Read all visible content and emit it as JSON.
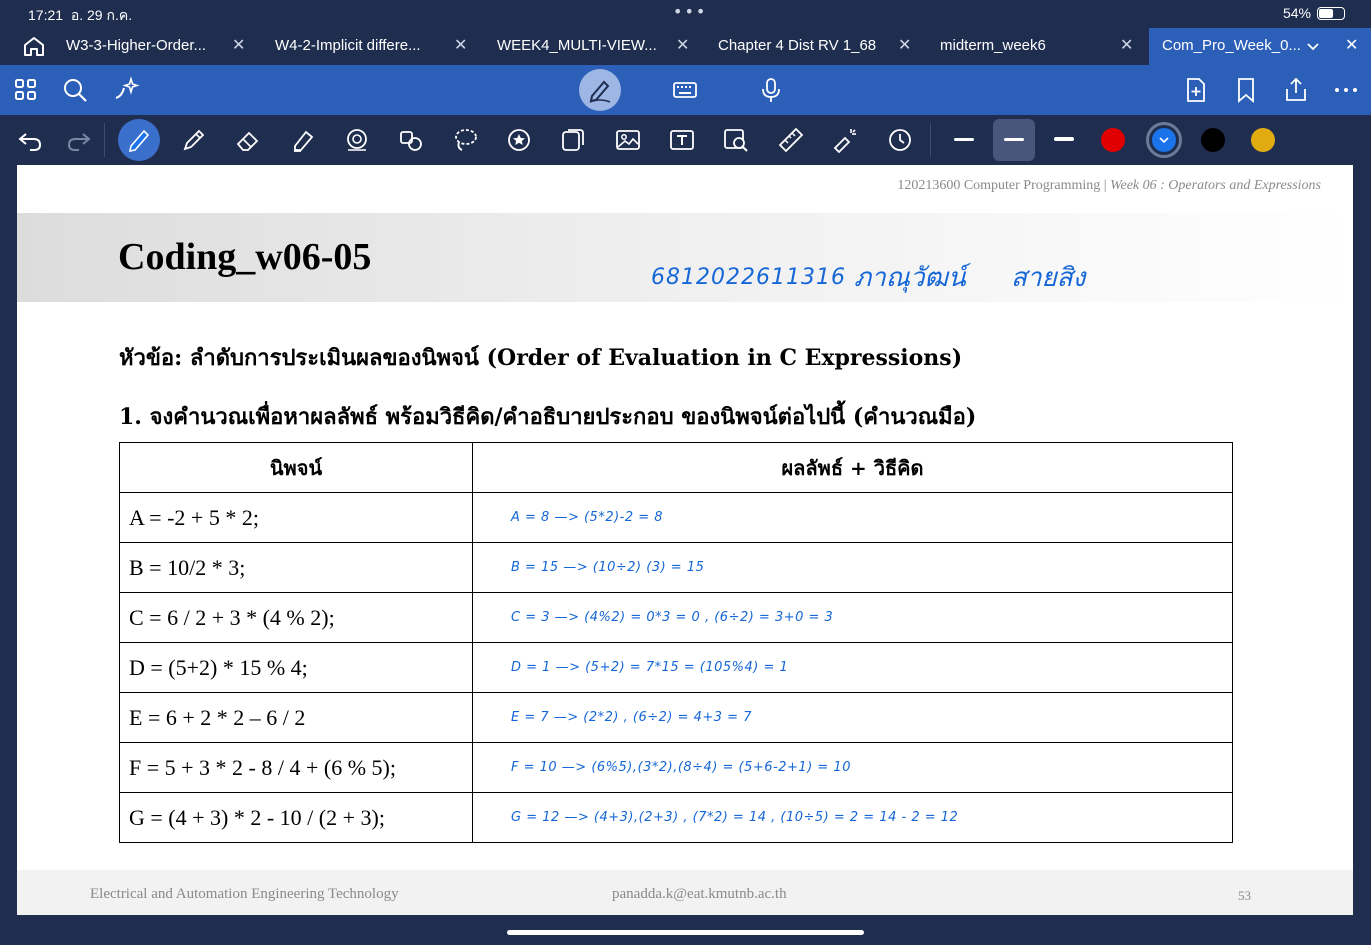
{
  "status": {
    "time": "17:21",
    "date": "อ. 29 ก.ค.",
    "dots": "•••",
    "battery": "54%"
  },
  "tabs": [
    {
      "label": "W3-3-Higher-Order...",
      "active": false
    },
    {
      "label": "W4-2-Implicit differe...",
      "active": false
    },
    {
      "label": "WEEK4_MULTI-VIEW...",
      "active": false
    },
    {
      "label": "Chapter 4 Dist RV 1_68",
      "active": false
    },
    {
      "label": "midterm_week6",
      "active": false
    },
    {
      "label": "Com_Pro_Week_0...",
      "active": true
    }
  ],
  "toolbar_top": {
    "left_icons": [
      "grid-icon",
      "search-icon",
      "sparkle-icon"
    ],
    "center_icons": [
      "pen-icon",
      "keyboard-icon",
      "microphone-icon"
    ],
    "right_icons": [
      "new-page-icon",
      "bookmark-icon",
      "share-icon",
      "more-icon"
    ]
  },
  "toolbar_tools": {
    "icons": [
      "undo-icon",
      "redo-icon",
      "pen-icon",
      "pencil-icon",
      "eraser-icon",
      "highlighter-icon",
      "shapes-icon",
      "elements-icon",
      "lasso-icon",
      "sticker-icon",
      "tape-icon",
      "image-icon",
      "textbox-icon",
      "camera-scan-icon",
      "ruler-icon",
      "laser-pointer-icon",
      "history-icon"
    ],
    "colors": {
      "red": "#e00000",
      "blue": "#1a73e8",
      "black": "#000000",
      "yellow": "#e0ac12"
    }
  },
  "slide": {
    "header_left": "120213600 Computer Programming | ",
    "header_right": "Week 06 : Operators and Expressions",
    "title": "Coding_w06-05",
    "handwritten": {
      "id": "6812022611316",
      "first_name": "ภาณุวัฒน์",
      "last_name": "สายสิง"
    },
    "topic": "หัวข้อ: ลำดับการประเมินผลของนิพจน์ (Order of Evaluation in C Expressions)",
    "question": "1. จงคำนวณเพื่อหาผลลัพธ์ พร้อมวิธีคิด/คำอธิบายประกอบ ของนิพจน์ต่อไปนี้ (คำนวณมือ)",
    "table": {
      "headers": [
        "นิพจน์",
        "ผลลัพธ์ + วิธีคิด"
      ],
      "rows": [
        {
          "expr": "A = -2 + 5 * 2;",
          "answer": "A = 8   —> (5*2)-2  = 8"
        },
        {
          "expr": "B = 10/2 * 3;",
          "answer": "B = 15   —> (10÷2) (3)  = 15"
        },
        {
          "expr": "C = 6 / 2 + 3 * (4 % 2);",
          "answer": "C = 3    —> (4%2) = 0*3 = 0 , (6÷2) = 3+0 = 3"
        },
        {
          "expr": "D = (5+2) * 15 % 4;",
          "answer": "D = 1    —> (5+2) = 7*15 = (105%4) = 1"
        },
        {
          "expr": "E = 6 + 2 * 2 – 6 / 2",
          "answer": "E = 7    —> (2*2) , (6÷2) = 4+3 = 7"
        },
        {
          "expr": "F = 5 + 3 * 2 - 8 / 4 + (6 % 5);",
          "answer": "F = 10   —> (6%5),(3*2),(8÷4) = (5+6-2+1) = 10"
        },
        {
          "expr": "G = (4 + 3) * 2 - 10 / (2 + 3);",
          "answer": "G = 12   —> (4+3),(2+3) , (7*2) = 14 , (10÷5) = 2  = 14 - 2  = 12"
        }
      ]
    },
    "footer": {
      "left": "Electrical and Automation Engineering Technology",
      "center": "panadda.k@eat.kmutnb.ac.th",
      "page": "53"
    }
  }
}
